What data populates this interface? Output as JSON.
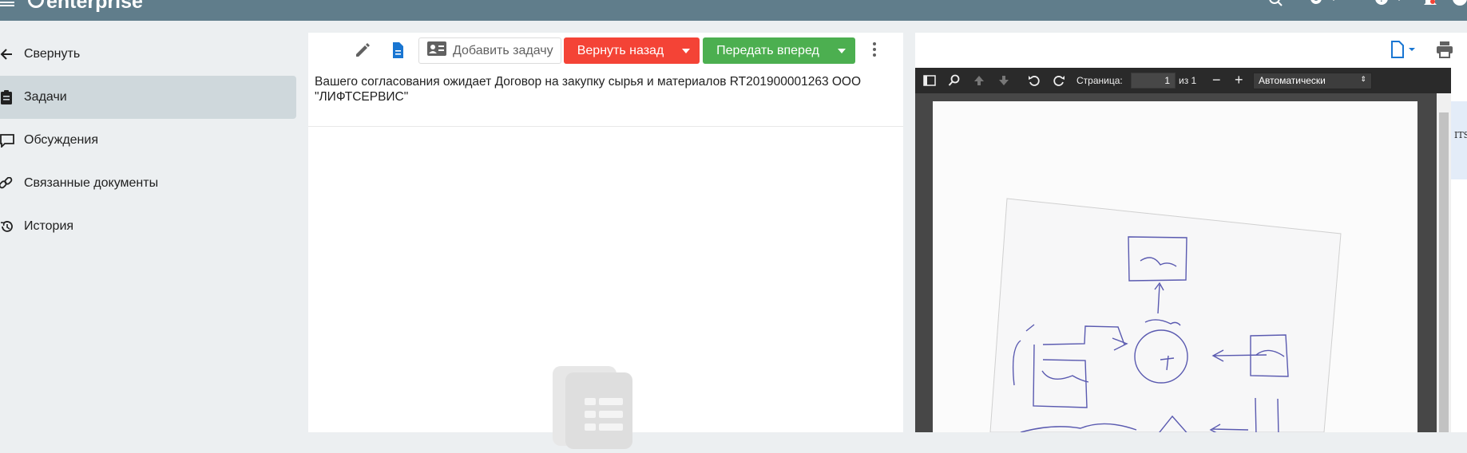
{
  "header": {
    "brand": "enterprise",
    "icons": [
      "menu-icon",
      "logo-icon",
      "search-icon",
      "settings-icon",
      "help-icon",
      "notifications-icon",
      "account-icon"
    ],
    "color": "#607d8b"
  },
  "sidebar": {
    "items": [
      {
        "label": "Свернуть",
        "icon": "arrow-left-icon"
      },
      {
        "label": "Задачи",
        "icon": "clipboard-icon",
        "active": true
      },
      {
        "label": "Обсуждения",
        "icon": "comment-icon"
      },
      {
        "label": "Связанные документы",
        "icon": "link-icon"
      },
      {
        "label": "История",
        "icon": "history-icon"
      }
    ],
    "active_color": "#cfd8dc"
  },
  "task_panel": {
    "add_task_label": "Добавить задачу",
    "return_label": "Вернуть назад",
    "forward_label": "Передать вперед",
    "task_text": "Вашего согласования ожидает Договор на закупку сырья и материалов  RT201900001263  ООО \"ЛИФТСЕРВИС\"",
    "colors": {
      "return": "#f44336",
      "forward": "#4caf50"
    }
  },
  "viewer": {
    "page_label": "Страница:",
    "page_value": "1",
    "page_total": "из 1",
    "zoom_value": "Автоматически",
    "side_text": "ITSc"
  }
}
